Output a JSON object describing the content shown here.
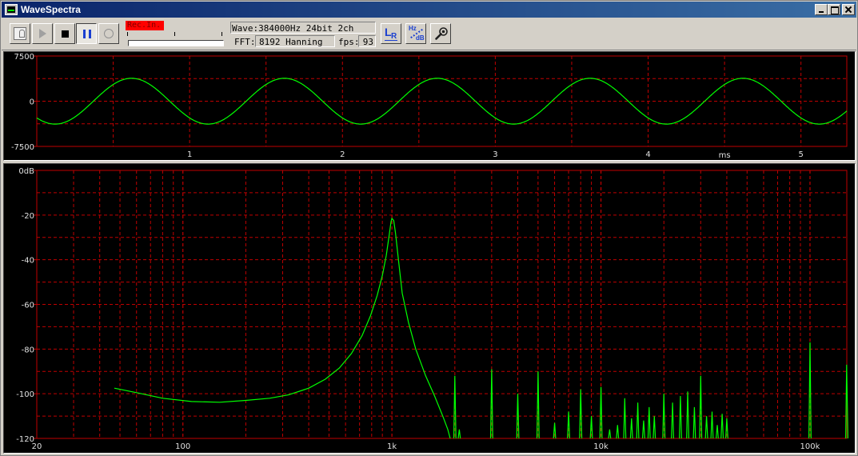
{
  "window": {
    "title": "WaveSpectra"
  },
  "toolbar": {
    "buttons": [
      {
        "name": "device-button",
        "icon": "audio-device-icon"
      },
      {
        "name": "play-button",
        "icon": "play-icon"
      },
      {
        "name": "stop-button",
        "icon": "stop-icon"
      },
      {
        "name": "pause-button",
        "icon": "pause-icon",
        "pressed": true
      },
      {
        "name": "record-button",
        "icon": "record-icon"
      }
    ],
    "rec_input_label": "Rec.In.",
    "wave_info": "Wave:384000Hz 24bit 2ch",
    "fft_label": "FFT:",
    "fft_value": "8192 Hanning",
    "fps_label": "fps:",
    "fps_value": "93",
    "lr_icon": {
      "big": "L",
      "small": "R"
    },
    "hzdb_icon": {
      "top": "Hz",
      "bottom": "dB"
    },
    "settings_icon": "wrench-icon",
    "colors": {
      "rec_badge": "#ff0000",
      "accent": "#1a3fd0"
    }
  },
  "waveform": {
    "y_tick_labels": [
      "7500",
      "0",
      "-7500"
    ],
    "x_tick_labels": [
      "1",
      "2",
      "3",
      "4",
      "5"
    ],
    "x_unit": "ms"
  },
  "spectrum": {
    "y_tick_labels": [
      "0dB",
      "-20",
      "-40",
      "-60",
      "-80",
      "-100",
      "-120"
    ],
    "x_tick_labels": [
      "20",
      "100",
      "1k",
      "10k",
      "100k"
    ]
  },
  "chart_data": [
    {
      "type": "line",
      "xlabel": "ms",
      "ylabel": "",
      "xlim": [
        0,
        5.3
      ],
      "ylim": [
        -7500,
        7500
      ],
      "yticks": [
        7500,
        0,
        -7500
      ],
      "xticks": [
        1,
        2,
        3,
        4,
        5
      ],
      "grid": true,
      "colors": {
        "trace": "#00ff00",
        "grid": "#c00000",
        "frame": "#c00000"
      },
      "series": [
        {
          "amplitude": 3800,
          "frequency_khz": 1.0,
          "phase_ms": 0.37
        }
      ]
    },
    {
      "type": "line",
      "log_x": true,
      "xlim": [
        20,
        150000
      ],
      "ylim": [
        -120,
        0
      ],
      "yticks": [
        0,
        -20,
        -40,
        -60,
        -80,
        -100,
        -120
      ],
      "xticks": [
        20,
        100,
        1000,
        10000,
        100000
      ],
      "grid": true,
      "colors": {
        "trace": "#00ff00",
        "grid": "#c00000",
        "frame": "#c00000"
      },
      "series": [
        {
          "points": [
            [
              47,
              -97.5
            ],
            [
              60,
              -99.5
            ],
            [
              80,
              -102
            ],
            [
              110,
              -103.5
            ],
            [
              150,
              -103.8
            ],
            [
              200,
              -103
            ],
            [
              260,
              -102
            ],
            [
              320,
              -100.5
            ],
            [
              400,
              -97.5
            ],
            [
              480,
              -93.5
            ],
            [
              560,
              -88.5
            ],
            [
              640,
              -82
            ],
            [
              720,
              -74
            ],
            [
              790,
              -65
            ],
            [
              850,
              -56
            ],
            [
              900,
              -47
            ],
            [
              940,
              -38
            ],
            [
              970,
              -29
            ],
            [
              990,
              -23
            ],
            [
              1000,
              -21.5
            ],
            [
              1020,
              -22.5
            ],
            [
              1040,
              -28
            ],
            [
              1080,
              -42
            ],
            [
              1120,
              -55
            ],
            [
              1200,
              -68
            ],
            [
              1300,
              -80
            ],
            [
              1450,
              -92
            ],
            [
              1600,
              -101
            ],
            [
              1750,
              -110
            ],
            [
              1850,
              -116
            ],
            [
              1900,
              -120
            ]
          ],
          "spikes": [
            [
              2000,
              -92
            ],
            [
              2100,
              -116
            ],
            [
              3000,
              -89
            ],
            [
              4000,
              -100
            ],
            [
              5000,
              -90
            ],
            [
              6000,
              -113
            ],
            [
              7000,
              -108
            ],
            [
              8000,
              -98
            ],
            [
              9000,
              -110
            ],
            [
              10000,
              -97
            ],
            [
              11000,
              -116
            ],
            [
              12000,
              -114
            ],
            [
              13000,
              -102
            ],
            [
              14000,
              -111
            ],
            [
              15000,
              -104
            ],
            [
              16000,
              -112
            ],
            [
              17000,
              -106
            ],
            [
              18000,
              -110
            ],
            [
              20000,
              -100
            ],
            [
              22000,
              -104
            ],
            [
              24000,
              -101
            ],
            [
              26000,
              -99
            ],
            [
              28000,
              -106
            ],
            [
              30000,
              -92
            ],
            [
              32000,
              -110
            ],
            [
              34000,
              -108
            ],
            [
              36000,
              -114
            ],
            [
              38000,
              -109
            ],
            [
              40000,
              -111
            ],
            [
              100000,
              -77
            ],
            [
              150000,
              -87
            ]
          ]
        }
      ]
    }
  ]
}
